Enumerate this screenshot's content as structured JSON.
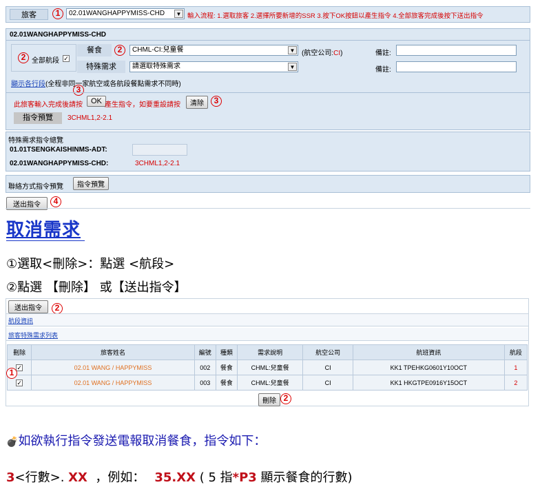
{
  "top": {
    "passenger_label": "旅客",
    "passenger_value": "02.01WANGHAPPYMISS-CHD",
    "flow_text": "輸入流程: 1.選取旅客 2.選擇所要新增的SSR 3.按下OK按鈕以產生指令 4.全部旅客完成後按下送出指令",
    "section_name": "02.01WANGHAPPYMISS-CHD",
    "all_segments_label": "全部航段",
    "meal_label": "餐食",
    "meal_value": "CHML-CI:兒童餐",
    "airline_prefix": "(航空公司:",
    "airline_code": "CI",
    "airline_suffix": ")",
    "remark_label": "備註:",
    "special_label": "特殊需求",
    "special_value": "請選取特殊需求",
    "show_segments_link": "顯示各行段",
    "show_segments_note": "(全程非同一家航空或各航段餐點需求不同時)",
    "done_text": "此旅客輸入完成後請按",
    "ok_label": "OK",
    "reset_text": "產生指令，如要重設請按",
    "clear_label": "清除",
    "preview_label": "指令預覽",
    "preview_value": "3CHML1,2-2.1",
    "summary_title": "特殊需求指令總覽",
    "summary_rows": [
      {
        "name": "01.01TSENGKAISHINMS-ADT:",
        "value": ""
      },
      {
        "name": "02.01WANGHAPPYMISS-CHD:",
        "value": "3CHML1,2-2.1"
      }
    ],
    "contact_label": "聯絡方式指令預覽",
    "contact_btn": "指令預覽",
    "send_btn": "送出指令"
  },
  "circles": {
    "c1": "1",
    "c2": "2",
    "c3": "3",
    "c4": "4"
  },
  "section": {
    "heading": "取消需求",
    "step1": "①選取<刪除>：點選  <航段>",
    "step2": "②點選 【刪除】 或【送出指令】"
  },
  "bottom": {
    "send_btn": "送出指令",
    "segment_info": "航段資訊",
    "ssr_list": "旅客特殊需求列表",
    "headers": [
      "刪除",
      "旅客姓名",
      "編號",
      "種類",
      "需求說明",
      "航空公司",
      "航班資訊",
      "航段"
    ],
    "rows": [
      {
        "name": "02.01 WANG / HAPPYMISS",
        "no": "002",
        "type": "餐食",
        "desc": "CHML:兒童餐",
        "airline": "CI",
        "flight": "KK1 TPEHKG0601Y10OCT",
        "seg": "1"
      },
      {
        "name": "02.01 WANG / HAPPYMISS",
        "no": "003",
        "type": "餐食",
        "desc": "CHML:兒童餐",
        "airline": "CI",
        "flight": "KK1 HKGTPE0916Y15OCT",
        "seg": "2"
      }
    ],
    "delete_btn": "刪除"
  },
  "note": {
    "bullet": "💣",
    "text": "如欲執行指令發送電報取消餐食，指令如下："
  },
  "cmd": {
    "prefix": "3",
    "middle": "<行數>. ",
    "xx": "XX",
    "example": "  ，例如：",
    "ex_value": "35.XX",
    "paren_open": " ( 5 指",
    "p3": "*P3",
    "paren_rest": " 顯示餐食的行數)"
  },
  "colors": {
    "accent_red": "#d60000",
    "link_blue": "#1a43b8",
    "panel_bg": "#dde8f3"
  }
}
